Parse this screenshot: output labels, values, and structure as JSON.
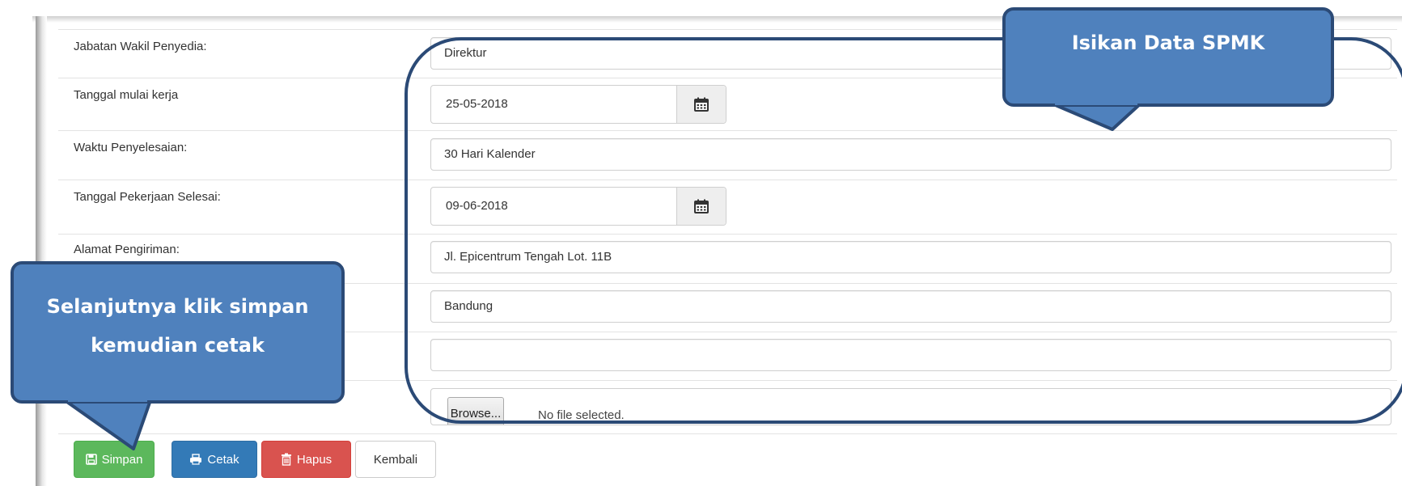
{
  "form": {
    "rows": [
      {
        "label": "Jabatan Wakil Penyedia:",
        "value": "Direktur",
        "type": "text"
      },
      {
        "label": "Tanggal mulai kerja",
        "value": "25-05-2018",
        "type": "date"
      },
      {
        "label": "Waktu Penyelesaian:",
        "value": "30 Hari Kalender",
        "type": "text"
      },
      {
        "label": "Tanggal Pekerjaan Selesai:",
        "value": "09-06-2018",
        "type": "date"
      },
      {
        "label": "Alamat Pengiriman:",
        "value": "Jl. Epicentrum Tengah Lot. 11B",
        "type": "text"
      },
      {
        "label": "",
        "value": "Bandung",
        "type": "text"
      },
      {
        "label": "",
        "value": "",
        "type": "text"
      }
    ],
    "file": {
      "browse_label": "Browse...",
      "status": "No file selected."
    }
  },
  "actions": {
    "simpan": "Simpan",
    "cetak": "Cetak",
    "hapus": "Hapus",
    "kembali": "Kembali"
  },
  "callouts": {
    "top": "Isikan Data SPMK",
    "left_line1": "Selanjutnya klik simpan",
    "left_line2": "kemudian cetak"
  },
  "colors": {
    "callout_fill": "#4f81bd",
    "callout_border": "#2b4a76",
    "success": "#5cb85c",
    "primary": "#337ab7",
    "danger": "#d9534f"
  },
  "icons": {
    "date": "calendar-icon",
    "simpan": "save-icon",
    "cetak": "print-icon",
    "hapus": "trash-icon"
  }
}
